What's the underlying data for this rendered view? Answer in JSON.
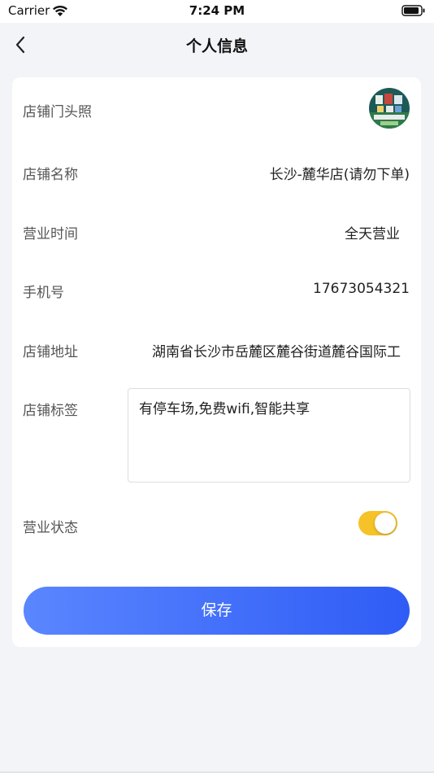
{
  "status_bar": {
    "carrier": "Carrier",
    "time": "7:24 PM"
  },
  "nav": {
    "title": "个人信息",
    "back_icon": "chevron-left-icon"
  },
  "form": {
    "storefront_photo": {
      "label": "店铺门头照"
    },
    "store_name": {
      "label": "店铺名称",
      "value": "长沙-麓华店(请勿下单)"
    },
    "business_hours": {
      "label": "营业时间",
      "value": "全天营业"
    },
    "phone": {
      "label": "手机号",
      "value": "17673054321"
    },
    "address": {
      "label": "店铺地址",
      "value": "湖南省长沙市岳麓区麓谷街道麓谷国际工"
    },
    "tags": {
      "label": "店铺标签",
      "value": "有停车场,免费wifi,智能共享"
    },
    "business_status": {
      "label": "营业状态",
      "enabled": true
    }
  },
  "save_button": {
    "label": "保存"
  },
  "colors": {
    "accent_start": "#5a86ff",
    "accent_end": "#2f5cf5",
    "toggle_on": "#f5c228",
    "background": "#f3f4f8"
  }
}
